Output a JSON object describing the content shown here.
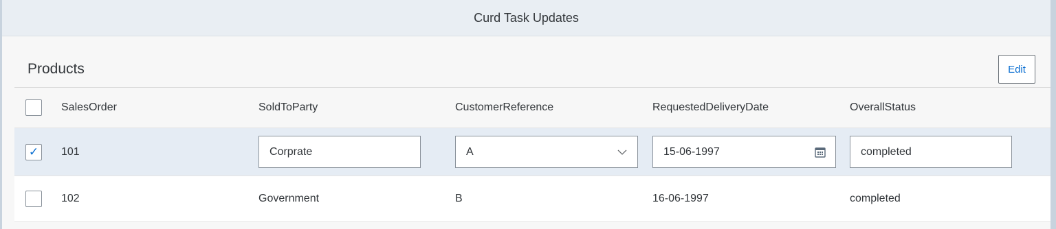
{
  "app": {
    "title": "Curd Task Updates"
  },
  "toolbar": {
    "title": "Products",
    "edit_label": "Edit"
  },
  "table": {
    "columns": [
      "SalesOrder",
      "SoldToParty",
      "CustomerReference",
      "RequestedDeliveryDate",
      "OverallStatus"
    ],
    "rows": [
      {
        "selected": true,
        "editing": true,
        "SalesOrder": "101",
        "SoldToParty": "Corprate",
        "CustomerReference": "A",
        "RequestedDeliveryDate": "15-06-1997",
        "OverallStatus": "completed"
      },
      {
        "selected": false,
        "editing": false,
        "SalesOrder": "102",
        "SoldToParty": "Government",
        "CustomerReference": "B",
        "RequestedDeliveryDate": "16-06-1997",
        "OverallStatus": "completed"
      }
    ]
  },
  "icons": {
    "check": "check-icon",
    "calendar": "calendar-icon",
    "dropdown": "chevron-down-icon"
  },
  "colors": {
    "accent": "#0a6ed1",
    "selected_row": "#e5ecf4",
    "header": "#e9eef3"
  }
}
